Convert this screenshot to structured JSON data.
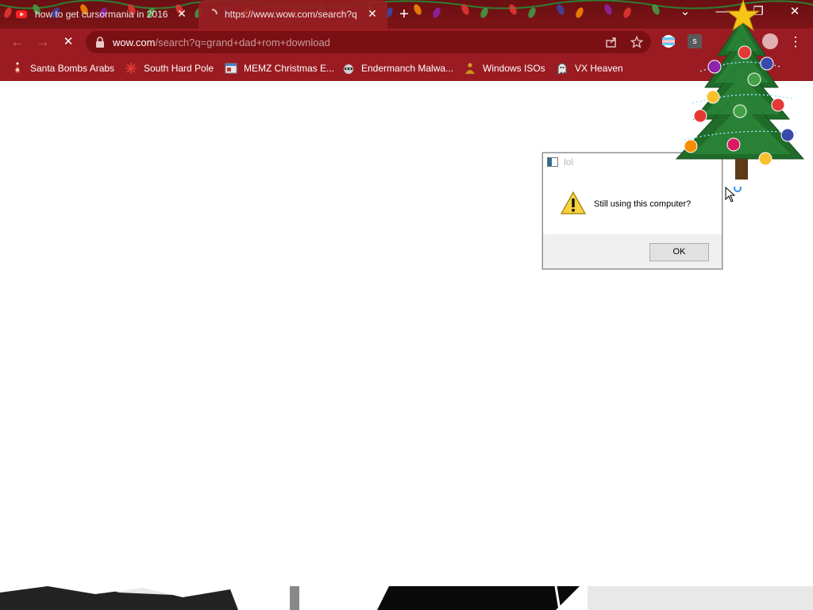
{
  "theme": {
    "frame": "#7d1417",
    "toolbar": "#9a1c22",
    "omnibox": "#7a1014",
    "accent": "#d63a3a"
  },
  "tabs": [
    {
      "title": "how to get cursormania in 2016",
      "favicon": "youtube-favicon",
      "active": false
    },
    {
      "title": "https://www.wow.com/search?q",
      "favicon": "loading-favicon",
      "active": true
    }
  ],
  "window_controls": {
    "tab_search": "⌄",
    "minimize": "—",
    "maximize": "❐",
    "close": "✕"
  },
  "toolbar": {
    "back": "←",
    "forward": "→",
    "reload": "✕",
    "url_host": "wow.com",
    "url_rest": "/search?q=grand+dad+rom+download",
    "omnibox_icons": [
      "share-icon",
      "bookmark-star-icon"
    ],
    "extensions": [
      "flag-extension-icon",
      "s-extension-icon",
      "puzzle-extension-icon",
      "profile-icon",
      "menu-icon"
    ],
    "extension_letter": "s",
    "menu": "⋮"
  },
  "bookmarks": [
    {
      "label": "Santa Bombs Arabs",
      "icon": "santa-icon"
    },
    {
      "label": "South Hard Pole",
      "icon": "snowflake-icon"
    },
    {
      "label": "MEMZ Christmas E...",
      "icon": "window-icon"
    },
    {
      "label": "Endermanch Malwa...",
      "icon": "raccoon-icon"
    },
    {
      "label": "Windows ISOs",
      "icon": "buddha-icon"
    },
    {
      "label": "VX Heaven",
      "icon": "ghost-icon"
    }
  ],
  "dialog": {
    "title": "lol",
    "message": "Still using this computer?",
    "ok_label": "OK",
    "icon": "warning-icon"
  },
  "decorations": {
    "tree": "christmas-tree-icon",
    "cursor": "busy-cursor-icon"
  }
}
